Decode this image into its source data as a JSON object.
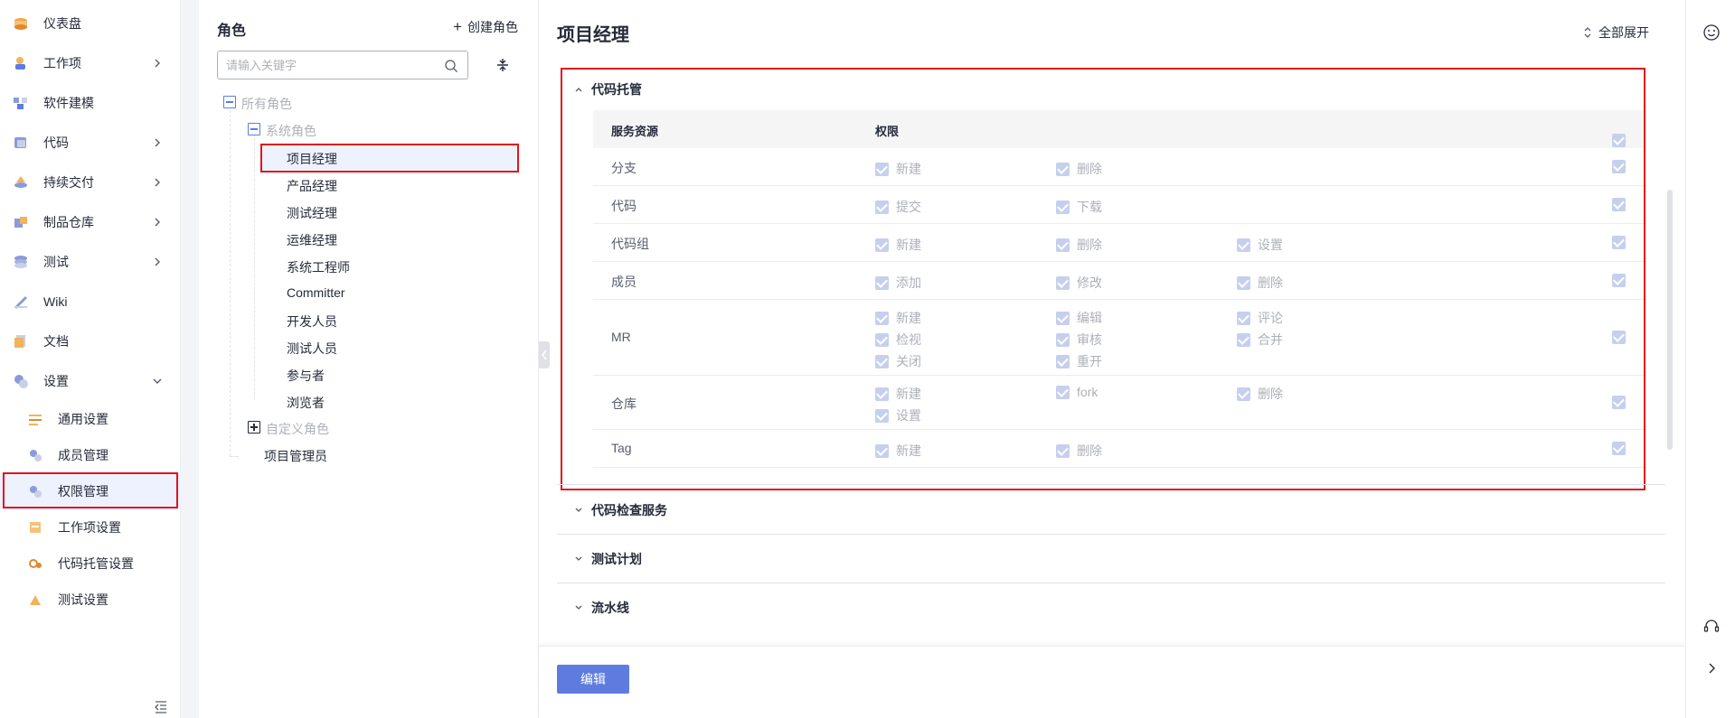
{
  "nav": {
    "items": [
      {
        "label": "仪表盘",
        "icon": "dashboard-icon",
        "arrow": false
      },
      {
        "label": "工作项",
        "icon": "workitem-icon",
        "arrow": true
      },
      {
        "label": "软件建模",
        "icon": "modeling-icon",
        "arrow": false
      },
      {
        "label": "代码",
        "icon": "code-icon",
        "arrow": true
      },
      {
        "label": "持续交付",
        "icon": "delivery-icon",
        "arrow": true
      },
      {
        "label": "制品仓库",
        "icon": "artifact-icon",
        "arrow": true
      },
      {
        "label": "测试",
        "icon": "test-icon",
        "arrow": true
      },
      {
        "label": "Wiki",
        "icon": "wiki-icon",
        "arrow": false
      },
      {
        "label": "文档",
        "icon": "docs-icon",
        "arrow": false
      },
      {
        "label": "设置",
        "icon": "settings-icon",
        "arrow": true
      }
    ],
    "settings_sub": [
      {
        "label": "通用设置",
        "icon": "general-settings-icon"
      },
      {
        "label": "成员管理",
        "icon": "member-icon"
      },
      {
        "label": "权限管理",
        "icon": "permission-icon",
        "active": true
      },
      {
        "label": "工作项设置",
        "icon": "workitem-settings-icon"
      },
      {
        "label": "代码托管设置",
        "icon": "repo-settings-icon"
      },
      {
        "label": "测试设置",
        "icon": "test-settings-icon"
      }
    ]
  },
  "roles": {
    "title": "角色",
    "create_label": "创建角色",
    "search_placeholder": "请输入关键字",
    "all_roles": "所有角色",
    "system_roles": "系统角色",
    "system_items": [
      "项目经理",
      "产品经理",
      "测试经理",
      "运维经理",
      "系统工程师",
      "Committer",
      "开发人员",
      "测试人员",
      "参与者",
      "浏览者"
    ],
    "custom_roles": "自定义角色",
    "admin": "项目管理员",
    "selected": "项目经理"
  },
  "main": {
    "title": "项目经理",
    "expand_all": "全部展开",
    "sections": {
      "code_hosting": "代码托管",
      "code_check": "代码检查服务",
      "test_plan": "测试计划",
      "pipeline": "流水线"
    },
    "table": {
      "col_resource": "服务资源",
      "col_permission": "权限",
      "rows": [
        {
          "name": "分支",
          "perms": [
            "新建",
            "删除"
          ]
        },
        {
          "name": "代码",
          "perms": [
            "提交",
            "下载"
          ]
        },
        {
          "name": "代码组",
          "perms": [
            "新建",
            "删除",
            "设置"
          ]
        },
        {
          "name": "成员",
          "perms": [
            "添加",
            "修改",
            "删除"
          ]
        },
        {
          "name": "MR",
          "perms": [
            "新建",
            "编辑",
            "评论",
            "检视",
            "审核",
            "合并",
            "关闭",
            "重开"
          ]
        },
        {
          "name": "仓库",
          "perms": [
            "新建",
            "fork",
            "删除",
            "设置"
          ]
        },
        {
          "name": "Tag",
          "perms": [
            "新建",
            "删除"
          ]
        }
      ]
    },
    "edit_button": "编辑"
  },
  "colors": {
    "accent": "#5e7ce0",
    "highlight_border": "#e0141e",
    "checkbox_disabled": "#c6d0ee"
  }
}
